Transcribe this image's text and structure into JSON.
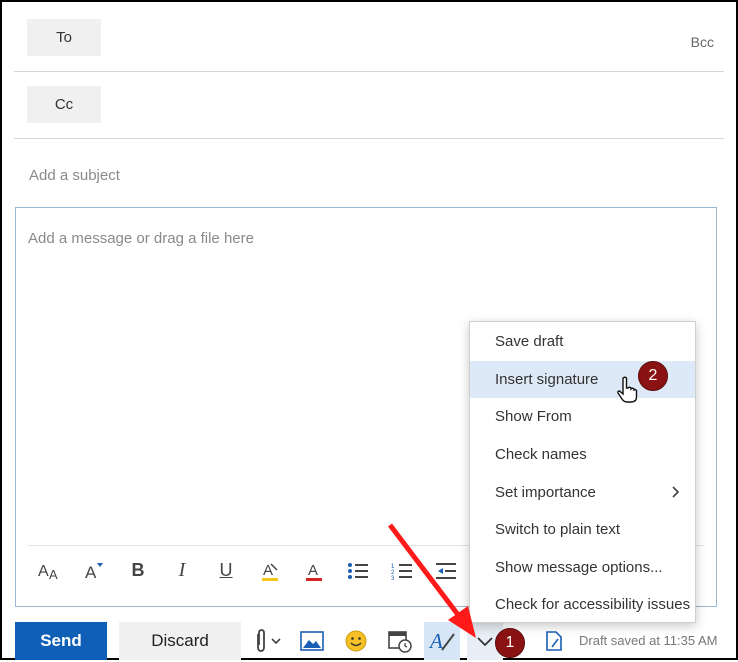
{
  "header": {
    "to_label": "To",
    "cc_label": "Cc",
    "bcc_label": "Bcc",
    "subject_placeholder": "Add a subject"
  },
  "body": {
    "placeholder": "Add a message or drag a file here"
  },
  "format_toolbar": {
    "icons": [
      "font-size-icon",
      "grow-font-icon",
      "bold-icon",
      "italic-icon",
      "underline-icon",
      "highlight-icon",
      "font-color-icon",
      "bullets-icon",
      "numbering-icon",
      "decrease-indent-icon"
    ],
    "bold": "B",
    "italic": "I",
    "underline": "U",
    "highlight_color": "#f5c518",
    "font_color": "#d62222"
  },
  "bottom_bar": {
    "send_label": "Send",
    "discard_label": "Discard",
    "draft_status": "Draft saved at 11:35 AM",
    "accent": "#0f5fb6"
  },
  "menu": {
    "items": [
      {
        "label": "Save draft"
      },
      {
        "label": "Insert signature"
      },
      {
        "label": "Show From"
      },
      {
        "label": "Check names"
      },
      {
        "label": "Set importance"
      },
      {
        "label": "Switch to plain text"
      },
      {
        "label": "Show message options..."
      },
      {
        "label": "Check for accessibility issues"
      }
    ],
    "hovered_index": 1
  },
  "annotations": {
    "badge_1": "1",
    "badge_2": "2",
    "badge_color": "#8b1212",
    "arrow_color": "#ff1a1a"
  }
}
